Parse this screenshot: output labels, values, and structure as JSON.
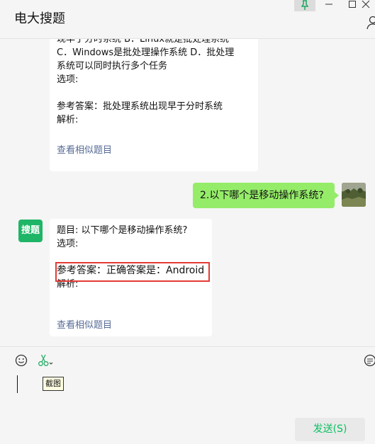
{
  "window": {
    "title": "电大搜题"
  },
  "messages": {
    "bot_first": {
      "lines": [
        "现早于分时系统 B．Linux就是批处理系统",
        "C．Windows是批处理操作系统 D．批处理",
        "系统可以同时执行多个任务",
        "选项:",
        "",
        "参考答案：批处理系统出现早于分时系统",
        "解析:"
      ],
      "link": "查看相似题目"
    },
    "user": {
      "text": "2.以下哪个是移动操作系统?"
    },
    "bot_second": {
      "avatar_text": "搜题",
      "lines": [
        "题目: 以下哪个是移动操作系统?",
        "选项:",
        ""
      ],
      "answer": "参考答案：正确答案是：Android",
      "analysis": "解析:",
      "link": "查看相似题目",
      "highlight_color": "#e53b35"
    }
  },
  "input": {
    "tooltip": "截图",
    "send_label": "发送(S)"
  },
  "colors": {
    "accent": "#07c160",
    "user_bubble": "#95ec69",
    "link": "#576b95"
  }
}
